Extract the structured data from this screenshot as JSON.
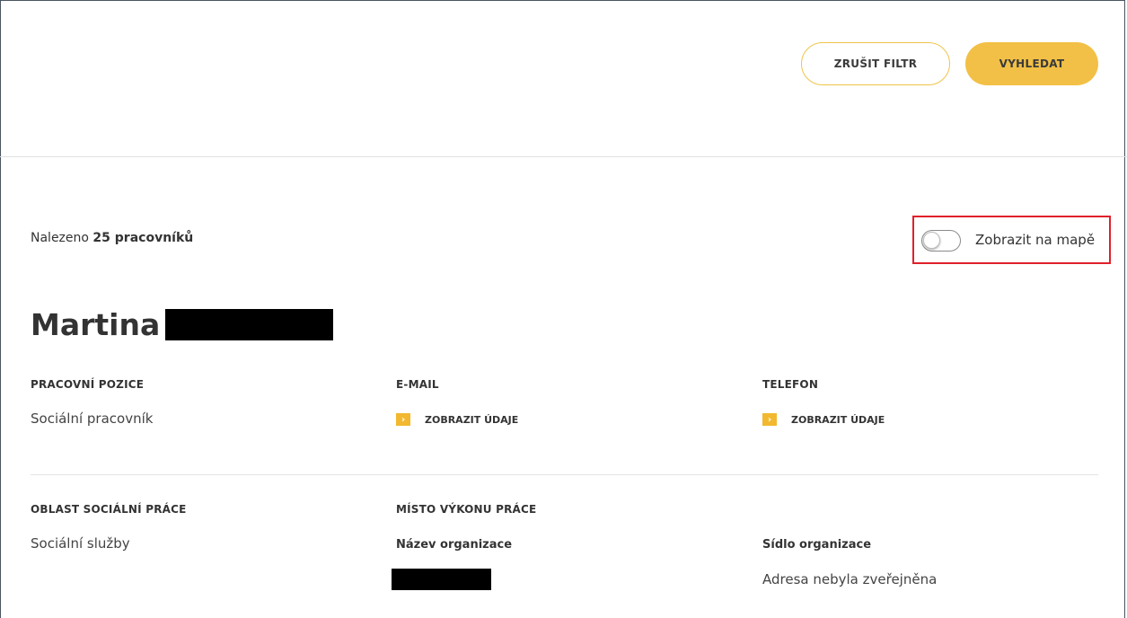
{
  "toolbar": {
    "cancel_filter_label": "ZRUŠIT FILTR",
    "search_label": "VYHLEDAT"
  },
  "results": {
    "found_prefix": "Nalezeno",
    "found_count": "25 pracovníků"
  },
  "map_toggle": {
    "label": "Zobrazit na mapě",
    "enabled": false
  },
  "person": {
    "first_name": "Martina",
    "fields": {
      "position_label": "PRACOVNÍ POZICE",
      "position_value": "Sociální pracovník",
      "email_label": "E-MAIL",
      "email_link": "ZOBRAZIT ÚDAJE",
      "phone_label": "TELEFON",
      "phone_link": "ZOBRAZIT ÚDAJE",
      "area_label": "OBLAST SOCIÁLNÍ PRÁCE",
      "area_value": "Sociální služby",
      "workplace_label": "MÍSTO VÝKONU PRÁCE",
      "org_name_label": "Název organizace",
      "org_seat_label": "Sídlo organizace",
      "org_seat_value": "Adresa nebyla zveřejněna"
    }
  },
  "colors": {
    "accent": "#f2c046",
    "highlight_border": "#e0202a"
  },
  "icons": {
    "link_arrow": "chevron-right-icon"
  }
}
